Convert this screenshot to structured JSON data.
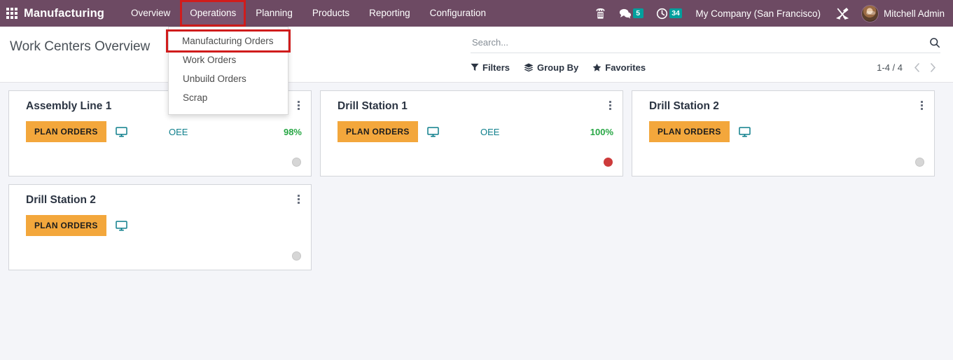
{
  "navbar": {
    "apps_icon": "apps-grid-icon",
    "brand": "Manufacturing",
    "menus": [
      {
        "label": "Overview",
        "active": false,
        "highlighted": false
      },
      {
        "label": "Operations",
        "active": true,
        "highlighted": true
      },
      {
        "label": "Planning",
        "active": false,
        "highlighted": false
      },
      {
        "label": "Products",
        "active": false,
        "highlighted": false
      },
      {
        "label": "Reporting",
        "active": false,
        "highlighted": false
      },
      {
        "label": "Configuration",
        "active": false,
        "highlighted": false
      }
    ],
    "phone_icon": "telephone-icon",
    "messages_icon": "messages-icon",
    "messages_count": "5",
    "activity_icon": "clock-activity-icon",
    "activity_count": "34",
    "company": "My Company (San Francisco)",
    "tools_icon": "wrench-screwdriver-icon",
    "avatar": "user-avatar",
    "user": "Mitchell Admin",
    "badge_color": "#00a09d",
    "bar_color": "#6d4a63"
  },
  "dropdown": {
    "open_for": "Operations",
    "items": [
      {
        "label": "Manufacturing Orders",
        "highlighted": true
      },
      {
        "label": "Work Orders",
        "highlighted": false
      },
      {
        "label": "Unbuild Orders",
        "highlighted": false
      },
      {
        "label": "Scrap",
        "highlighted": false
      }
    ],
    "highlight_color": "#d01c1c"
  },
  "control_panel": {
    "title": "Work Centers Overview",
    "search": {
      "placeholder": "Search...",
      "value": "",
      "icon": "search-icon"
    },
    "buttons": [
      {
        "label": "Filters",
        "icon": "filter-icon"
      },
      {
        "label": "Group By",
        "icon": "layers-icon"
      },
      {
        "label": "Favorites",
        "icon": "star-icon"
      }
    ],
    "pager": {
      "range": "1-4 / 4",
      "prev_icon": "chevron-left-icon",
      "next_icon": "chevron-right-icon"
    }
  },
  "kanban": {
    "plan_orders_label": "PLAN ORDERS",
    "plan_orders_color": "#f3a73c",
    "oee_label": "OEE",
    "monitor_icon": "monitor-icon",
    "menu_icon": "kebab-menu-icon",
    "cards": [
      {
        "title": "Assembly Line 1",
        "has_oee": true,
        "oee_value": "98%",
        "status": "gray"
      },
      {
        "title": "Drill Station 1",
        "has_oee": true,
        "oee_value": "100%",
        "status": "red"
      },
      {
        "title": "Drill Station 2",
        "has_oee": false,
        "oee_value": "",
        "status": "gray"
      },
      {
        "title": "Drill Station 2",
        "has_oee": false,
        "oee_value": "",
        "status": "gray"
      }
    ]
  }
}
